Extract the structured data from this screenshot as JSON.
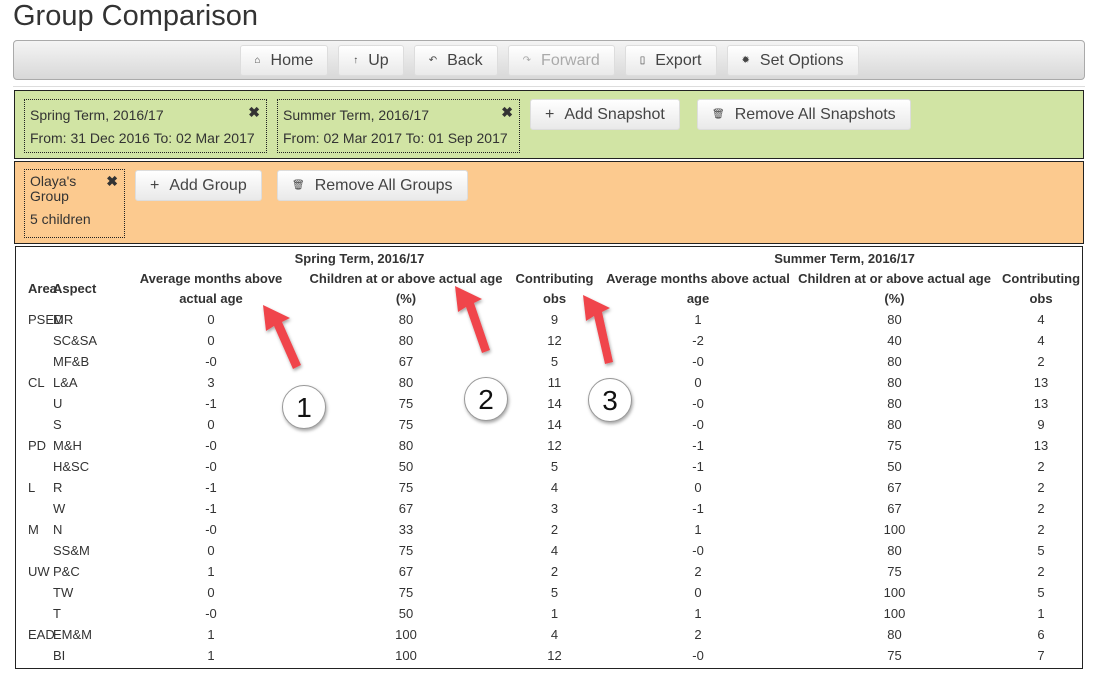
{
  "page_title": "Group Comparison",
  "toolbar": {
    "home": "Home",
    "up": "Up",
    "back": "Back",
    "forward": "Forward",
    "export": "Export",
    "set_options": "Set Options"
  },
  "snapshots": [
    {
      "title": "Spring Term, 2016/17",
      "range": "From: 31 Dec 2016 To: 02 Mar 2017"
    },
    {
      "title": "Summer Term, 2016/17",
      "range": "From: 02 Mar 2017 To: 01 Sep 2017"
    }
  ],
  "snapshot_actions": {
    "add": "Add Snapshot",
    "remove_all": "Remove All Snapshots"
  },
  "groups": [
    {
      "name": "Olaya's Group",
      "count": "5 children"
    }
  ],
  "group_actions": {
    "add": "Add Group",
    "remove_all": "Remove All Groups"
  },
  "table": {
    "term1": "Spring Term, 2016/17",
    "term2": "Summer Term, 2016/17",
    "headers": [
      "Area",
      "Aspect",
      "Average months above actual age",
      "Children at or above actual age (%)",
      "Contributing obs",
      "Average months above actual age",
      "Children at or above actual age (%)",
      "Contributing obs"
    ],
    "rows": [
      [
        "PSED",
        "MR",
        "0",
        "80",
        "9",
        "1",
        "80",
        "4"
      ],
      [
        "",
        "SC&SA",
        "0",
        "80",
        "12",
        "-2",
        "40",
        "4"
      ],
      [
        "",
        "MF&B",
        "-0",
        "67",
        "5",
        "-0",
        "80",
        "2"
      ],
      [
        "CL",
        "L&A",
        "3",
        "80",
        "11",
        "0",
        "80",
        "13"
      ],
      [
        "",
        "U",
        "-1",
        "75",
        "14",
        "-0",
        "80",
        "13"
      ],
      [
        "",
        "S",
        "0",
        "75",
        "14",
        "-0",
        "80",
        "9"
      ],
      [
        "PD",
        "M&H",
        "-0",
        "80",
        "12",
        "-1",
        "75",
        "13"
      ],
      [
        "",
        "H&SC",
        "-0",
        "50",
        "5",
        "-1",
        "50",
        "2"
      ],
      [
        "L",
        "R",
        "-1",
        "75",
        "4",
        "0",
        "67",
        "2"
      ],
      [
        "",
        "W",
        "-1",
        "67",
        "3",
        "-1",
        "67",
        "2"
      ],
      [
        "M",
        "N",
        "-0",
        "33",
        "2",
        "1",
        "100",
        "2"
      ],
      [
        "",
        "SS&M",
        "0",
        "75",
        "4",
        "-0",
        "80",
        "5"
      ],
      [
        "UW",
        "P&C",
        "1",
        "67",
        "2",
        "2",
        "75",
        "2"
      ],
      [
        "",
        "TW",
        "0",
        "75",
        "5",
        "0",
        "100",
        "5"
      ],
      [
        "",
        "T",
        "-0",
        "50",
        "1",
        "1",
        "100",
        "1"
      ],
      [
        "EAD",
        "EM&M",
        "1",
        "100",
        "4",
        "2",
        "80",
        "6"
      ],
      [
        "",
        "BI",
        "1",
        "100",
        "12",
        "-0",
        "75",
        "7"
      ]
    ]
  },
  "callouts": [
    "1",
    "2",
    "3"
  ],
  "colors": {
    "snapshot_bg": "#d1e4a4",
    "group_bg": "#fcca8f",
    "arrow": "#f0444b"
  }
}
